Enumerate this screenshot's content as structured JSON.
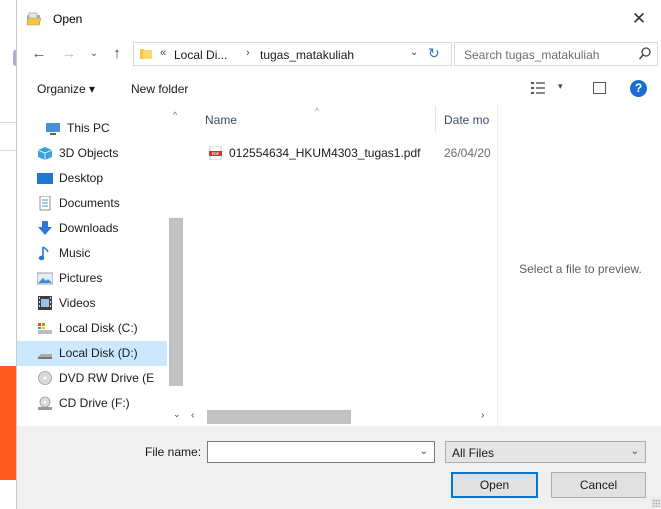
{
  "window": {
    "title": "Open",
    "close_glyph": "✕"
  },
  "address": {
    "back_glyph": "←",
    "forward_glyph": "→",
    "recent_glyph": "⌄",
    "up_glyph": "↑",
    "overflow_glyph": "«",
    "crumb_sep": "›",
    "crumbs": [
      "Local Di...",
      "tugas_matakuliah"
    ],
    "dropdown_glyph": "⌄",
    "refresh_glyph": "↻"
  },
  "search": {
    "placeholder": "Search tugas_matakuliah"
  },
  "toolbar": {
    "organize_label": "Organize ▾",
    "new_folder_label": "New folder",
    "view_dropdown_glyph": "▾",
    "help_glyph": "?"
  },
  "nav": {
    "items": [
      {
        "label": "This PC",
        "icon": "pc-icon"
      },
      {
        "label": "3D Objects",
        "icon": "cube-icon"
      },
      {
        "label": "Desktop",
        "icon": "desktop-icon"
      },
      {
        "label": "Documents",
        "icon": "documents-icon"
      },
      {
        "label": "Downloads",
        "icon": "downloads-icon"
      },
      {
        "label": "Music",
        "icon": "music-icon"
      },
      {
        "label": "Pictures",
        "icon": "pictures-icon"
      },
      {
        "label": "Videos",
        "icon": "videos-icon"
      },
      {
        "label": "Local Disk (C:)",
        "icon": "system-drive-icon"
      },
      {
        "label": "Local Disk (D:)",
        "icon": "drive-icon",
        "selected": true
      },
      {
        "label": "DVD RW Drive (E",
        "icon": "dvd-drive-icon"
      },
      {
        "label": "CD Drive (F:)",
        "icon": "cd-drive-icon"
      }
    ],
    "scroll_up_glyph": "^",
    "scroll_down_glyph": "⌄"
  },
  "files": {
    "columns": {
      "name": "Name",
      "date": "Date mo",
      "sort_glyph": "^"
    },
    "rows": [
      {
        "name": "012554634_HKUM4303_tugas1.pdf",
        "date": "26/04/20",
        "icon": "pdf-icon"
      }
    ],
    "scroll_left_glyph": "‹",
    "scroll_right_glyph": "›"
  },
  "preview": {
    "message": "Select a file to preview."
  },
  "bottom": {
    "file_name_label": "File name:",
    "file_name_value": "",
    "file_name_dropdown_glyph": "⌄",
    "filter_value": "All Files",
    "filter_dropdown_glyph": "⌄",
    "open_label": "Open",
    "cancel_label": "Cancel"
  },
  "colors": {
    "accent": "#0078d7",
    "selection": "#cce8ff",
    "help_blue": "#1c6cd8",
    "background_orange": "#ff5a1f"
  }
}
